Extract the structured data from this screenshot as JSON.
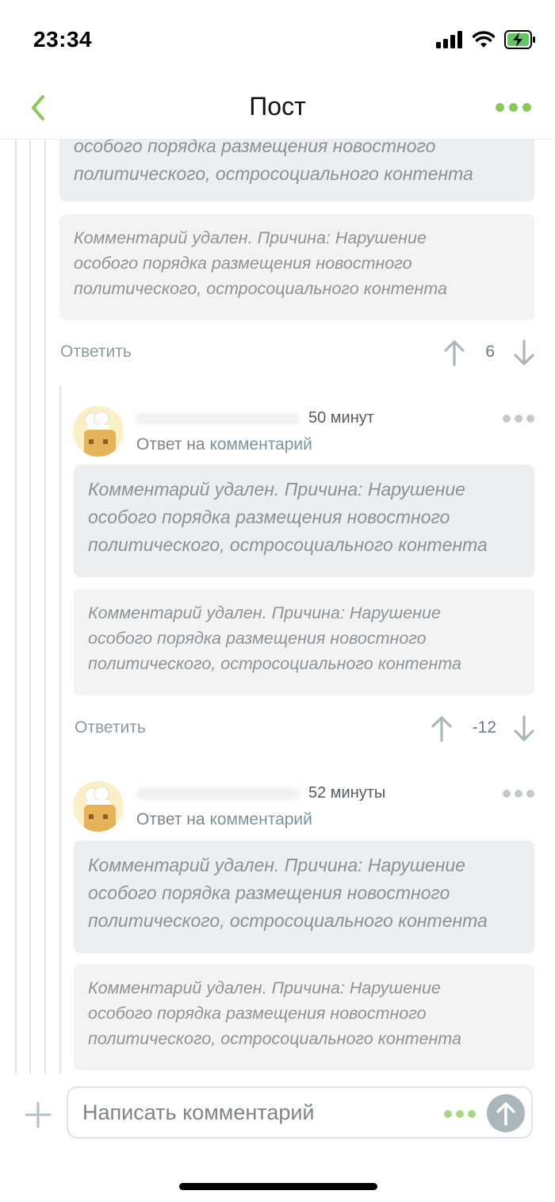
{
  "status_bar": {
    "time": "23:34"
  },
  "nav": {
    "title": "Пост"
  },
  "deleted_text_lines": [
    "Комментарий удален. Причина: Нарушение",
    "особого порядка размещения новостного",
    "политического, остросоциального контента"
  ],
  "comments": [
    {
      "reply_label": "Ответить",
      "votes": "6"
    },
    {
      "time": "50 минут",
      "reply_to_prefix": "Ответ на",
      "reply_to_link": "комментарий",
      "reply_label": "Ответить",
      "votes": "-12"
    },
    {
      "time": "52 минуты",
      "reply_to_prefix": "Ответ на",
      "reply_to_link": "комментарий"
    }
  ],
  "composer": {
    "placeholder": "Написать комментарий"
  },
  "colors": {
    "accent": "#8ac858",
    "muted_link": "#8b9ba0",
    "deleted_bg": "#eceff2"
  },
  "icons": [
    "back-chevron-icon",
    "more-dots-icon",
    "upvote-arrow-icon",
    "downvote-arrow-icon",
    "avatar-chef-icon",
    "plus-icon",
    "send-arrow-icon"
  ]
}
